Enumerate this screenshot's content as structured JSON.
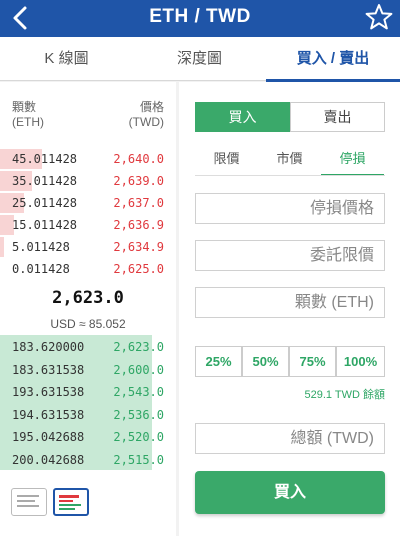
{
  "header": {
    "title": "ETH / TWD"
  },
  "tabs": [
    "K 線圖",
    "深度圖",
    "買入 / 賣出"
  ],
  "orderbook": {
    "qty_header": [
      "顆數",
      "(ETH)"
    ],
    "price_header": [
      "價格",
      "(TWD)"
    ],
    "asks": [
      {
        "qty": "45.011428",
        "price": "2,640.0",
        "depth": 0.3
      },
      {
        "qty": "35.011428",
        "price": "2,639.0",
        "depth": 0.23
      },
      {
        "qty": "25.011428",
        "price": "2,637.0",
        "depth": 0.17
      },
      {
        "qty": "15.011428",
        "price": "2,636.9",
        "depth": 0.1
      },
      {
        "qty": "5.011428",
        "price": "2,634.9",
        "depth": 0.03
      },
      {
        "qty": "0.011428",
        "price": "2,625.0",
        "depth": 0.0
      }
    ],
    "last_price": "2,623.0",
    "usd_text": "USD ≈ 85.052",
    "bids": [
      {
        "qty": "183.620000",
        "price": "2,623.0"
      },
      {
        "qty": "183.631538",
        "price": "2,600.0"
      },
      {
        "qty": "193.631538",
        "price": "2,543.0"
      },
      {
        "qty": "194.631538",
        "price": "2,536.0"
      },
      {
        "qty": "195.042688",
        "price": "2,520.0"
      },
      {
        "qty": "200.042688",
        "price": "2,515.0"
      }
    ]
  },
  "trade": {
    "buy_label": "買入",
    "sell_label": "賣出",
    "order_types": [
      "限價",
      "市價",
      "停損"
    ],
    "stop_price_placeholder": "停損價格",
    "limit_price_placeholder": "委託限價",
    "qty_placeholder": "顆數 (ETH)",
    "percentages": [
      "25%",
      "50%",
      "75%",
      "100%"
    ],
    "balance_text": "529.1 TWD 餘額",
    "total_placeholder": "總額 (TWD)",
    "submit_label": "買入"
  },
  "colors": {
    "brand": "#1f55a8",
    "buy": "#3aa96a",
    "ask": "#e0393e"
  }
}
